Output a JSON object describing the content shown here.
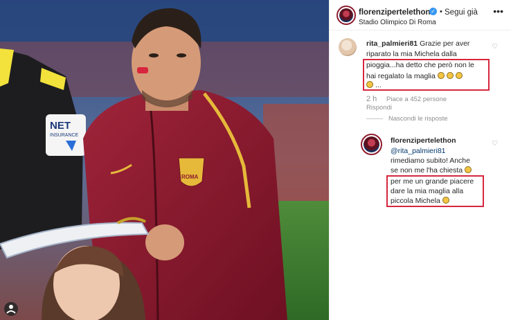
{
  "post": {
    "username": "florenzipertelethon",
    "follow_label": "Segui già",
    "location": "Stadio Olimpico Di Roma",
    "photo_texts": {
      "sponsor_line1": "NET",
      "sponsor_line2": "INSURANCE",
      "crest": "ROMA"
    }
  },
  "comments": [
    {
      "username": "rita_palmieri81",
      "lines": [
        "Grazie per aver",
        "riparato la mia Michela dalla",
        "pioggia...ha detto che però non le",
        "hai regalato la maglia",
        "..."
      ],
      "time": "2 h",
      "likes": "Piace a 452 persone",
      "reply_label": "Rispondi",
      "hide_replies": "Nascondi le risposte"
    },
    {
      "username": "florenzipertelethon",
      "mention": "@rita_palmieri81",
      "lines": [
        "rimediamo subito! Anche",
        "se non me l'ha chiesta",
        "per me un grande piacere",
        "dare la mia maglia alla",
        "piccola Michela"
      ]
    }
  ],
  "icons": {
    "verified": "verified-badge-icon",
    "more": "more-options-icon",
    "like": "heart-icon",
    "emoji": "laughing-emoji-icon"
  },
  "colors": {
    "highlight": "#d7263d",
    "roma_red": "#8e1b2e",
    "verified": "#3897f0"
  }
}
